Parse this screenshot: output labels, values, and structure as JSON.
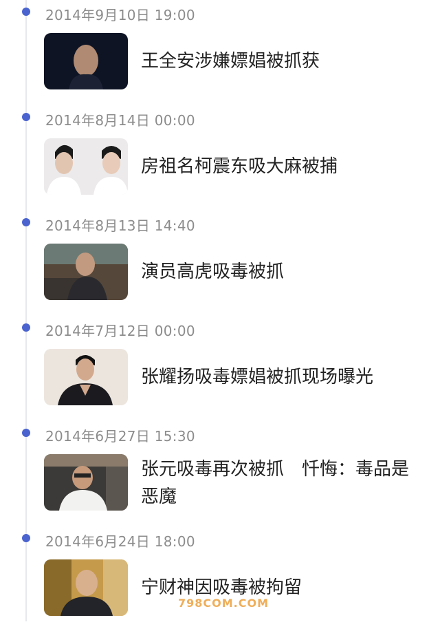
{
  "timeline": [
    {
      "date": "2014年9月10日 19:00",
      "title": "王全安涉嫌嫖娼被抓获",
      "thumb": "portrait-dark-bald-man"
    },
    {
      "date": "2014年8月14日 00:00",
      "title": "房祖名柯震东吸大麻被捕",
      "thumb": "two-young-men-white-shirts"
    },
    {
      "date": "2014年8月13日 14:40",
      "title": "演员高虎吸毒被抓",
      "thumb": "man-in-patterned-jacket-indoor"
    },
    {
      "date": "2014年7月12日 00:00",
      "title": "张耀扬吸毒嫖娼被抓现场曝光",
      "thumb": "man-in-black-suit"
    },
    {
      "date": "2014年6月27日 15:30",
      "title": "张元吸毒再次被抓　忏悔：毒品是恶魔",
      "thumb": "man-in-white-jacket-glasses"
    },
    {
      "date": "2014年6月24日 18:00",
      "title": "宁财神因吸毒被拘留",
      "thumb": "bald-man-smiling-striped-shirt"
    }
  ],
  "watermark": {
    "line1": "█████",
    "line2": "798COM.COM"
  },
  "colors": {
    "dot": "#4a63cf",
    "date": "#8c8c8c",
    "title": "#222222",
    "line": "#e6e8ef"
  }
}
